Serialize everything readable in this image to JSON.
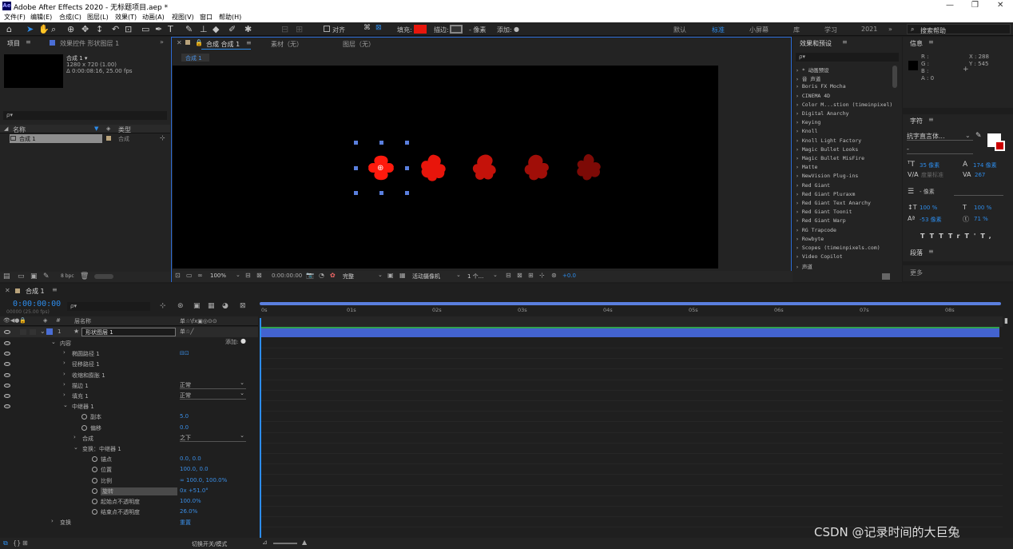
{
  "titlebar": {
    "app_icon": "Ae",
    "title": "Adobe After Effects 2020 - 无标题项目.aep *"
  },
  "menu": [
    "文件(F)",
    "编辑(E)",
    "合成(C)",
    "图层(L)",
    "效果(T)",
    "动画(A)",
    "视图(V)",
    "窗口",
    "帮助(H)"
  ],
  "toolbar": {
    "align_label": "对齐",
    "fill_label": "填充:",
    "stroke_label": "描边:",
    "stroke_px": "- 像素",
    "add_label": "添加:",
    "fill_color": "#e8160c"
  },
  "workspaces": [
    "默认",
    "标准",
    "小屏幕",
    "库",
    "学习",
    "2021"
  ],
  "search_help": "搜索帮助",
  "project": {
    "tab": "项目",
    "effect_controls": "效果控件 形状图层 1",
    "comp_name": "合成 1 ▾",
    "comp_size": "1280 x 720 (1.00)",
    "comp_duration": "Δ 0:00:08:16, 25.00 fps",
    "search_placeholder": "ρ▾",
    "col_name": "名称",
    "col_type": "类型",
    "item_name": "合成 1",
    "item_type": "合成",
    "bpc": "8 bpc"
  },
  "viewer": {
    "tab": "合成 合成 1",
    "footage_tab": "素材（无）",
    "layer_tab": "图层（无）",
    "subtab": "合成 1",
    "zoom": "100%",
    "timecode": "0:00:00:00",
    "quality": "完整",
    "camera": "活动摄像机",
    "views": "1 个...",
    "exposure": "+0.0"
  },
  "effects": {
    "tab": "效果和预设",
    "items": [
      "* 动画预设",
      "音 声道",
      "Boris FX Mocha",
      "CINEMA 4D",
      "Color M...stion (timeinpixel)",
      "Digital Anarchy",
      "Keying",
      "Knoll",
      "Knoll Light Factory",
      "Magic Bullet Looks",
      "Magic Bullet MisFire",
      "Matte",
      "NewVision Plug-ins",
      "Red Giant",
      "Red Giant Pluraxm",
      "Red Giant Text Anarchy",
      "Red Giant Toonit",
      "Red Giant Warp",
      "RG Trapcode",
      "Rowbyte",
      "Scopes (timeinpixels.com)",
      "Video Copilot",
      "声道"
    ]
  },
  "info": {
    "tab": "信息",
    "r": "R :",
    "g": "G :",
    "b": "B :",
    "a": "A : 0",
    "x": "X : 288",
    "y": "Y : 545"
  },
  "character": {
    "tab": "字符",
    "font": "抗字直言体...",
    "style": "-",
    "size": "35 像素",
    "leading": "174 像素",
    "kerning": "度量标准",
    "tracking": "267",
    "stroke": "- 像素",
    "vscale": "100 %",
    "hscale": "100 %",
    "baseline": "-53 像素",
    "tsume": "71 %"
  },
  "paragraph_tab": "段落",
  "more_tab": "更多",
  "timeline": {
    "tab": "合成 1",
    "timecode": "0:00:00:00",
    "fps": "00000 (25.00 fps)",
    "col_layer_name": "层名称",
    "col_switches": "单☆\\fx▣◎⊙⊙",
    "layer_index": "1",
    "layer_name": "形状图层 1",
    "add_label": "添加:",
    "ruler": [
      "0s",
      "01s",
      "02s",
      "03s",
      "04s",
      "05s",
      "06s",
      "07s",
      "08s"
    ],
    "toggle_label": "切换开关/模式"
  },
  "props": [
    {
      "name": "内容",
      "indent": 75
    },
    {
      "name": "椭圆路径 1",
      "indent": 90
    },
    {
      "name": "径移路径 1",
      "indent": 90
    },
    {
      "name": "收缩和膨胀 1",
      "indent": 90
    },
    {
      "name": "描边 1",
      "indent": 90,
      "dd": "正常"
    },
    {
      "name": "填充 1",
      "indent": 90,
      "dd": "正常"
    },
    {
      "name": "中继器 1",
      "indent": 90
    },
    {
      "name": "副本",
      "indent": 113,
      "val": "5.0"
    },
    {
      "name": "偏移",
      "indent": 113,
      "val": "0.0"
    },
    {
      "name": "合成",
      "indent": 103,
      "dd": "之下"
    },
    {
      "name": "变换：中继器 1",
      "indent": 103
    },
    {
      "name": "锚点",
      "indent": 126,
      "val": "0.0, 0.0"
    },
    {
      "name": "位置",
      "indent": 126,
      "val": "100.0, 0.0"
    },
    {
      "name": "比例",
      "indent": 126,
      "val": "∞ 100.0, 100.0%"
    },
    {
      "name": "旋转",
      "indent": 126,
      "val": "0x +51.0°"
    },
    {
      "name": "起始点不透明度",
      "indent": 126,
      "val": "100.0%"
    },
    {
      "name": "结束点不透明度",
      "indent": 126,
      "val": "26.0%"
    },
    {
      "name": "变换",
      "indent": 75,
      "val": "重置"
    }
  ],
  "watermark": "CSDN @记录时间的大巨兔",
  "shapes": [
    {
      "color": "#ff1a0d"
    },
    {
      "color": "#e8150b"
    },
    {
      "color": "#c4120a"
    },
    {
      "color": "#a00e08"
    },
    {
      "color": "#7d0a06"
    }
  ]
}
